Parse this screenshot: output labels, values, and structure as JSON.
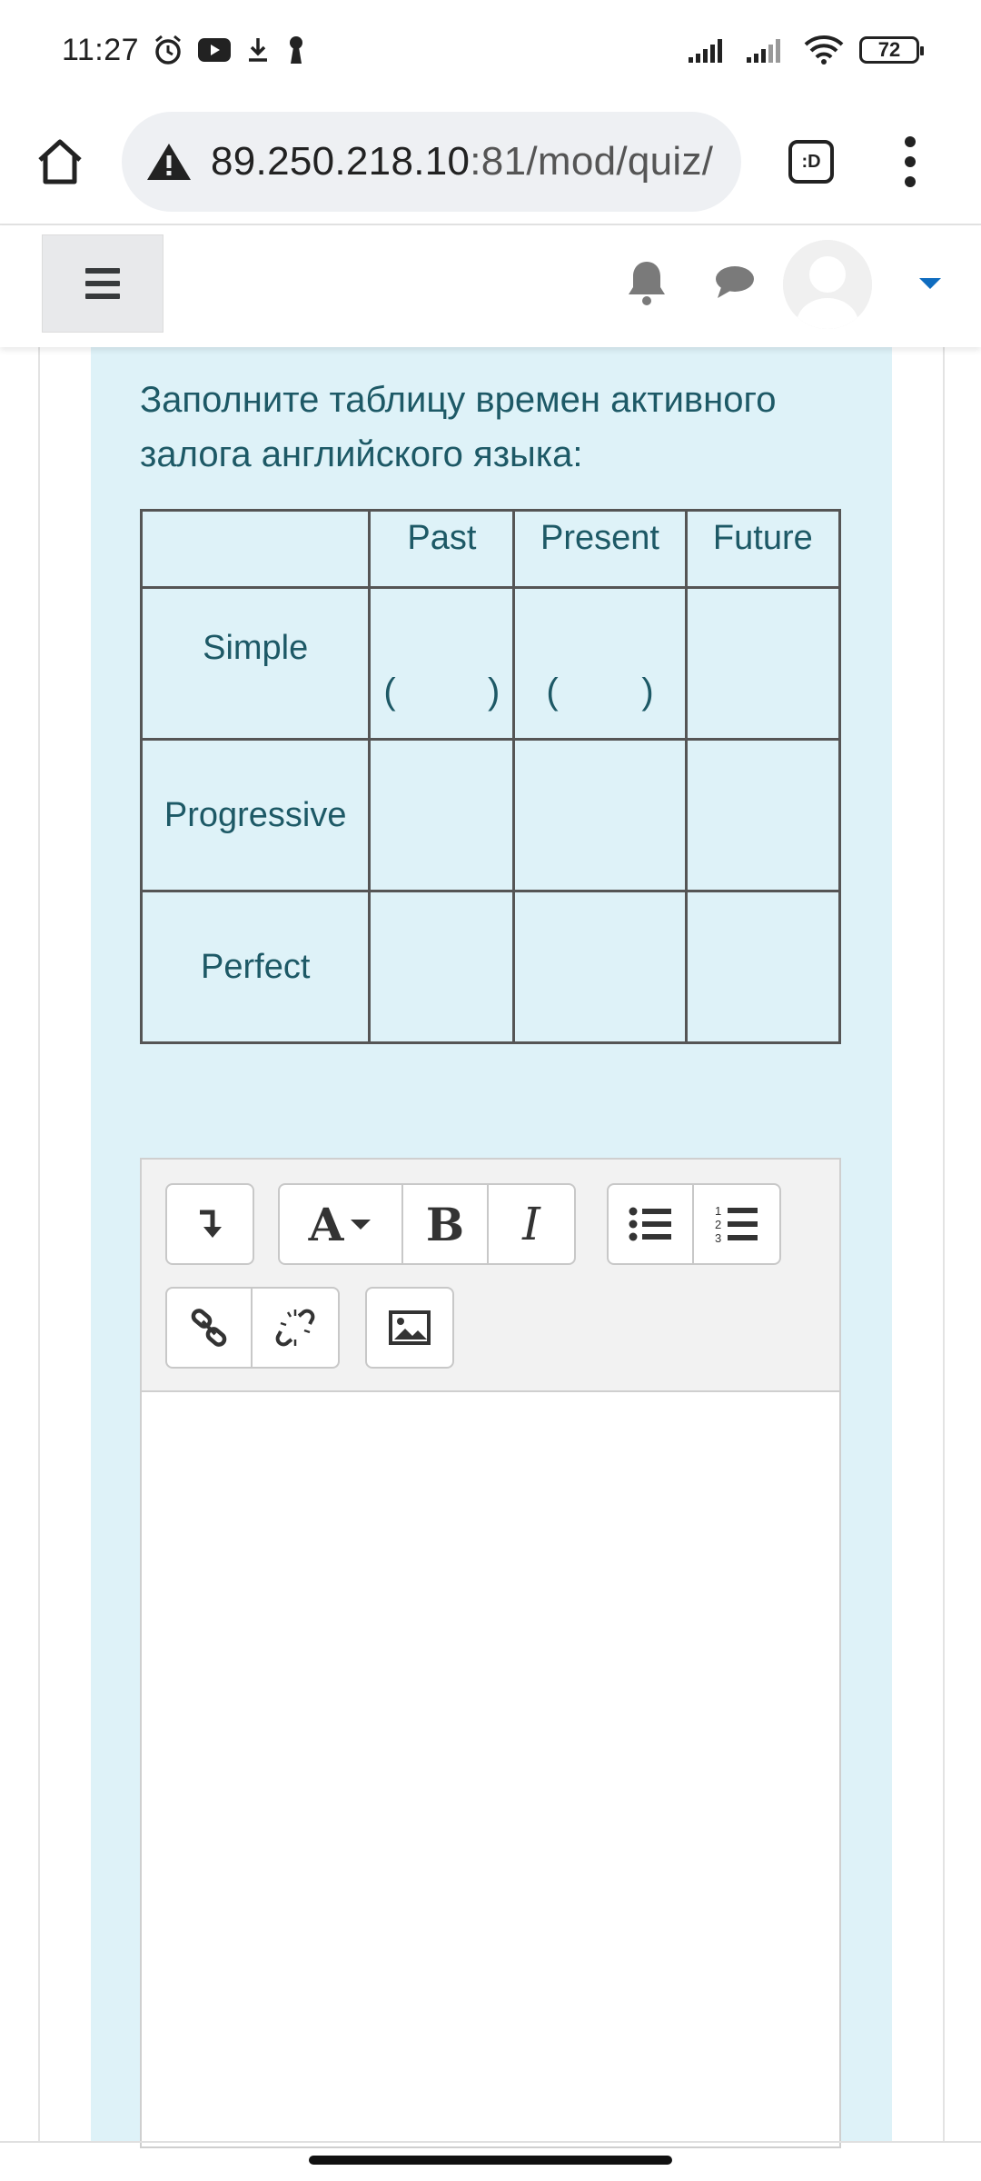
{
  "status_bar": {
    "time": "11:27",
    "battery": "72"
  },
  "browser": {
    "url_host": "89.250.218.10",
    "url_rest": ":81/mod/quiz/",
    "tabs_label": ":D"
  },
  "question": {
    "text": "Заполните таблицу времен активного залога английского языка:",
    "columns": [
      "",
      "Past",
      "Present",
      "Future"
    ],
    "rows": [
      {
        "label": "Simple",
        "cells": [
          "(        )",
          "(        )",
          ""
        ]
      },
      {
        "label": "Progressive",
        "cells": [
          "",
          "",
          ""
        ]
      },
      {
        "label": "Perfect",
        "cells": [
          "",
          "",
          ""
        ]
      }
    ],
    "paren_open": "(",
    "paren_close": ")"
  },
  "editor": {
    "font_label": "A",
    "bold_label": "B",
    "italic_label": "I",
    "content": ""
  },
  "colors": {
    "question_bg": "#def2f8",
    "question_text": "#1d5966",
    "accent": "#0f6cbf"
  }
}
